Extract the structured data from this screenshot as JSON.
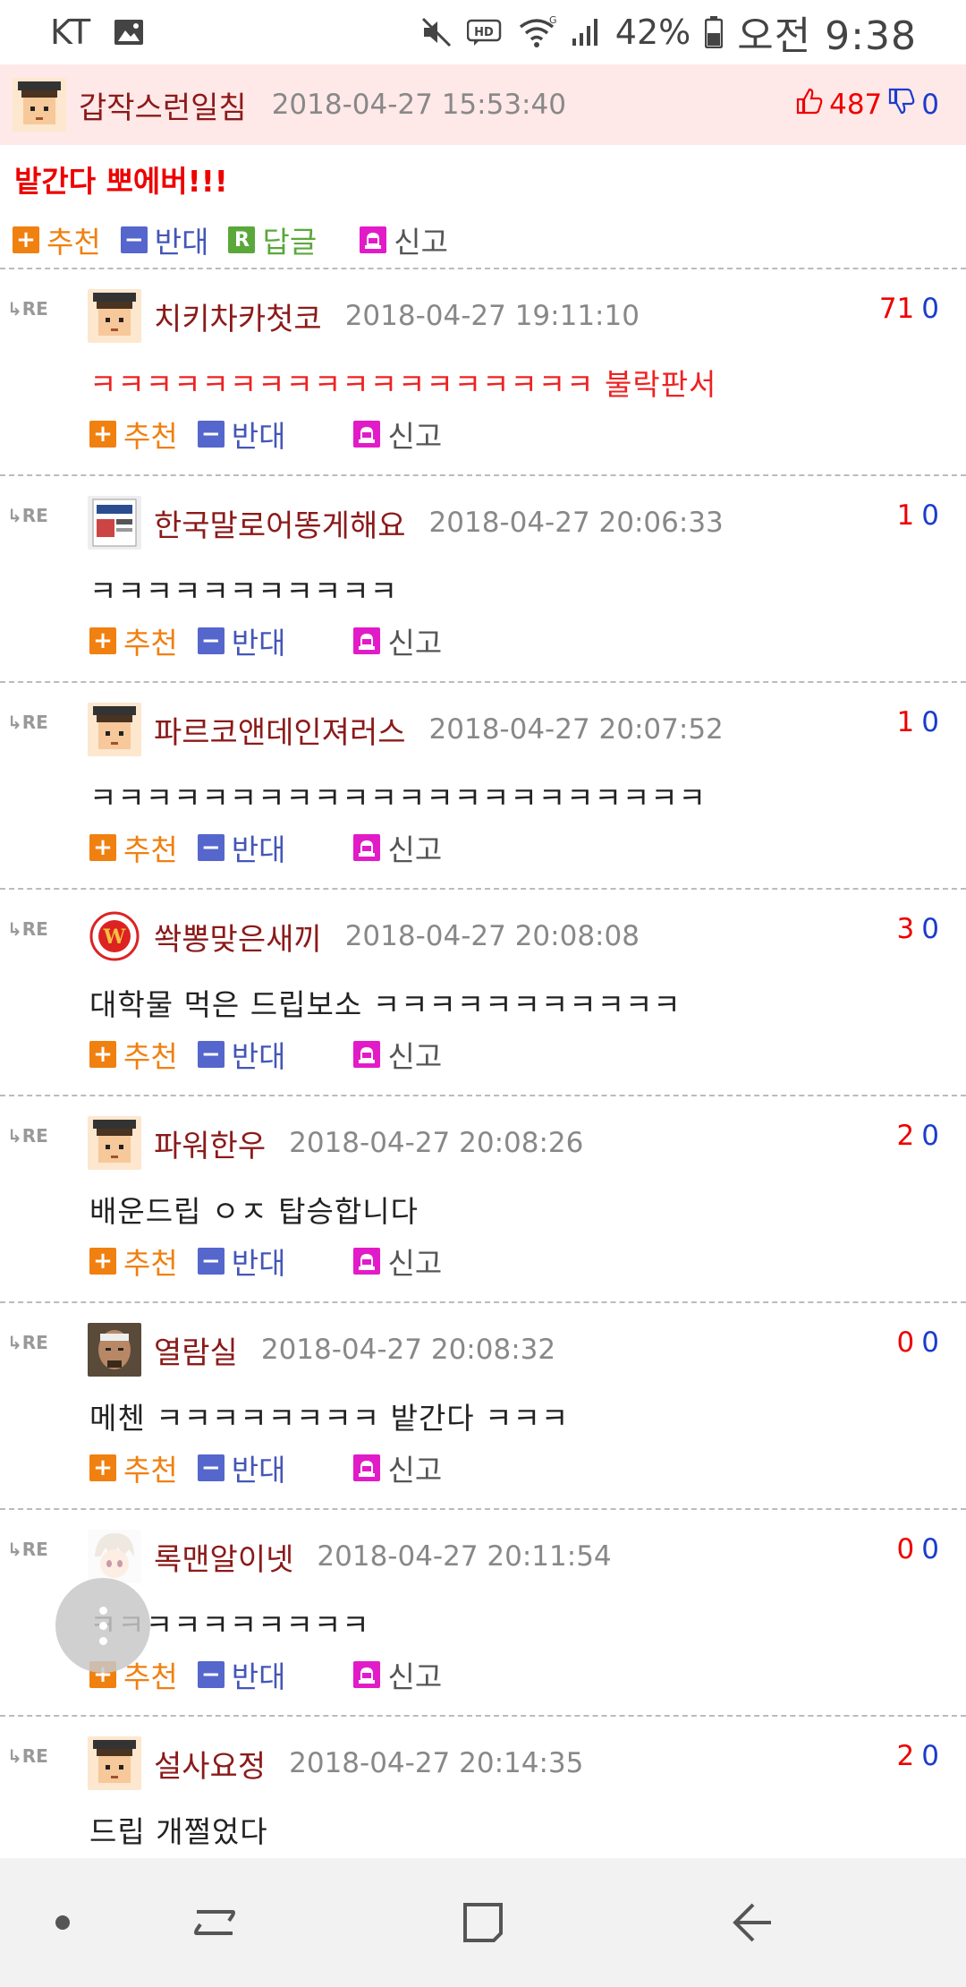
{
  "status_bar": {
    "carrier": "KT",
    "battery": "42%",
    "time": "오전 9:38",
    "icons": [
      "image-icon",
      "mute-icon",
      "hd-icon",
      "wifi-icon",
      "signal-icon",
      "battery-icon"
    ]
  },
  "post": {
    "author": "갑작스런일침",
    "date": "2018-04-27 15:53:40",
    "up": "487",
    "down": "0",
    "body": "밭간다 뽀에버!!!",
    "actions": {
      "recommend": "추천",
      "oppose": "반대",
      "reply": "답글",
      "report": "신고"
    }
  },
  "re_label": "RE",
  "comment_actions": {
    "recommend": "추천",
    "oppose": "반대",
    "report": "신고"
  },
  "comments": [
    {
      "author": "치키차카첫코",
      "date": "2018-04-27 19:11:10",
      "up": "71",
      "down": "0",
      "body": "ㅋㅋㅋㅋㅋㅋㅋㅋㅋㅋㅋㅋㅋㅋㅋㅋㅋㅋ 불락판서",
      "avatar": "pixel-character"
    },
    {
      "author": "한국말로어똥게해요",
      "date": "2018-04-27 20:06:33",
      "up": "1",
      "down": "0",
      "body": "ㅋㅋㅋㅋㅋㅋㅋㅋㅋㅋㅋ",
      "avatar": "book-cover"
    },
    {
      "author": "파르코앤데인져러스",
      "date": "2018-04-27 20:07:52",
      "up": "1",
      "down": "0",
      "body": "ㅋㅋㅋㅋㅋㅋㅋㅋㅋㅋㅋㅋㅋㅋㅋㅋㅋㅋㅋㅋㅋㅋ",
      "avatar": "pixel-character"
    },
    {
      "author": "쏵뽕맞은새끼",
      "date": "2018-04-27 20:08:08",
      "up": "3",
      "down": "0",
      "body": "대학물 먹은 드립보소 ㅋㅋㅋㅋㅋㅋㅋㅋㅋㅋㅋ",
      "avatar": "team-logo"
    },
    {
      "author": "파워한우",
      "date": "2018-04-27 20:08:26",
      "up": "2",
      "down": "0",
      "body": "배운드립 ㅇㅈ 탑승합니다",
      "avatar": "pixel-character"
    },
    {
      "author": "열람실",
      "date": "2018-04-27 20:08:32",
      "up": "0",
      "down": "0",
      "body": "메첸 ㅋㅋㅋㅋㅋㅋㅋㅋ 밭간다 ㅋㅋㅋ",
      "avatar": "photo-face"
    },
    {
      "author": "록맨알이넷",
      "date": "2018-04-27 20:11:54",
      "up": "0",
      "down": "0",
      "body": "ㅋㅋㅋㅋㅋㅋㅋㅋㅋㅋ",
      "avatar": "anime-face"
    },
    {
      "author": "설사요정",
      "date": "2018-04-27 20:14:35",
      "up": "2",
      "down": "0",
      "body": "드립 개쩔었다",
      "avatar": "pixel-character"
    }
  ]
}
